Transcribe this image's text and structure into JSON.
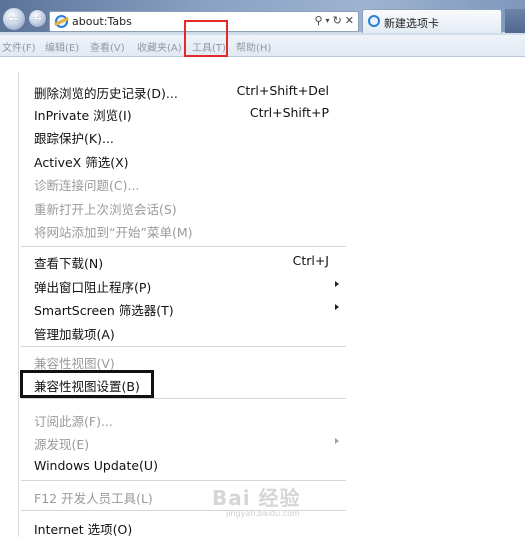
{
  "address_bar": {
    "url": "about:Tabs",
    "search_icon": "search-icon",
    "dropdown_icon": "chevron-down-icon",
    "refresh_icon": "refresh-icon",
    "stop_icon": "close-icon"
  },
  "tab": {
    "title": "新建选项卡"
  },
  "menubar": {
    "file": "文件(F)",
    "edit": "编辑(E)",
    "view": "查看(V)",
    "favorites": "收藏夹(A)",
    "tools": "工具(T)",
    "help": "帮助(H)"
  },
  "tools_menu": {
    "items": [
      {
        "label": "删除浏览的历史记录(D)...",
        "shortcut": "Ctrl+Shift+Del",
        "enabled": true
      },
      {
        "label": "InPrivate 浏览(I)",
        "shortcut": "Ctrl+Shift+P",
        "enabled": true
      },
      {
        "label": "跟踪保护(K)...",
        "shortcut": "",
        "enabled": true
      },
      {
        "label": "ActiveX 筛选(X)",
        "shortcut": "",
        "enabled": true
      },
      {
        "label": "诊断连接问题(C)...",
        "shortcut": "",
        "enabled": false
      },
      {
        "label": "重新打开上次浏览会话(S)",
        "shortcut": "",
        "enabled": false
      },
      {
        "label": "将网站添加到“开始”菜单(M)",
        "shortcut": "",
        "enabled": false
      },
      {
        "label": "查看下载(N)",
        "shortcut": "Ctrl+J",
        "enabled": true
      },
      {
        "label": "弹出窗口阻止程序(P)",
        "shortcut": "",
        "enabled": true,
        "submenu": true
      },
      {
        "label": "SmartScreen 筛选器(T)",
        "shortcut": "",
        "enabled": true,
        "submenu": true
      },
      {
        "label": "管理加载项(A)",
        "shortcut": "",
        "enabled": true
      },
      {
        "label": "兼容性视图(V)",
        "shortcut": "",
        "enabled": false
      },
      {
        "label": "兼容性视图设置(B)",
        "shortcut": "",
        "enabled": true
      },
      {
        "label": "订阅此源(F)...",
        "shortcut": "",
        "enabled": false
      },
      {
        "label": "源发现(E)",
        "shortcut": "",
        "enabled": false,
        "submenu": true
      },
      {
        "label": "Windows Update(U)",
        "shortcut": "",
        "enabled": true
      },
      {
        "label": "F12 开发人员工具(L)",
        "shortcut": "",
        "enabled": false
      },
      {
        "label": "Internet 选项(O)",
        "shortcut": "",
        "enabled": true
      }
    ]
  },
  "watermark": {
    "text": "Bai 经验",
    "sub": "jingyan.baidu.com"
  },
  "colors": {
    "highlight_red": "#e32a2a",
    "highlight_black": "#111111",
    "disabled_text": "#9a9a9a"
  }
}
